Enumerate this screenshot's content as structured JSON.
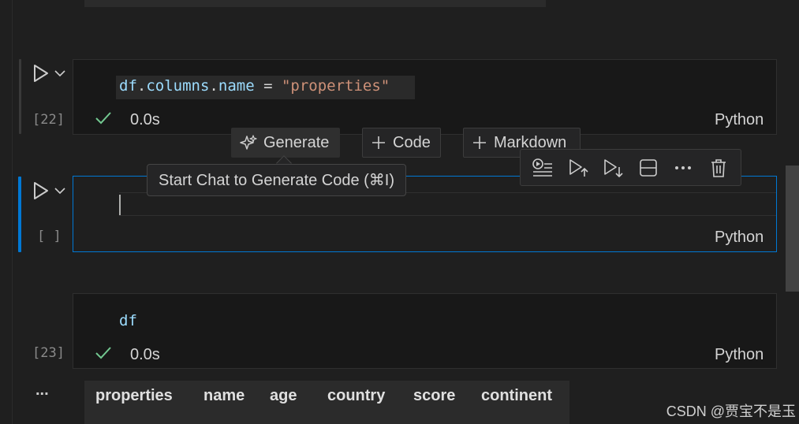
{
  "cells": [
    {
      "code_tokens": [
        {
          "text": "df",
          "kind": "var"
        },
        {
          "text": ".",
          "kind": "op"
        },
        {
          "text": "columns",
          "kind": "var"
        },
        {
          "text": ".",
          "kind": "op"
        },
        {
          "text": "name",
          "kind": "var"
        },
        {
          "text": " = ",
          "kind": "op"
        },
        {
          "text": "\"properties\"",
          "kind": "str"
        }
      ],
      "exec_count": "[22]",
      "status_time": "0.0s",
      "language": "Python"
    },
    {
      "code_tokens": [],
      "exec_count": "[ ]",
      "language": "Python"
    },
    {
      "code_tokens": [
        {
          "text": "df",
          "kind": "var"
        }
      ],
      "exec_count": "[23]",
      "status_time": "0.0s",
      "language": "Python"
    }
  ],
  "insert_bar": {
    "generate_label": "Generate",
    "code_label": "Code",
    "markdown_label": "Markdown"
  },
  "tooltip": {
    "text": "Start Chat to Generate Code (⌘I)"
  },
  "cell_toolbar": {
    "icons": [
      "run-by-line-icon",
      "execute-above-icon",
      "execute-below-icon",
      "split-cell-icon",
      "more-icon",
      "delete-icon"
    ]
  },
  "output": {
    "more_label": "...",
    "columns": [
      "properties",
      "name",
      "age",
      "country",
      "score",
      "continent"
    ]
  },
  "watermark": "CSDN @贾宝不是玉",
  "colors": {
    "accent": "#0078d4",
    "success": "#73c991",
    "string": "#ce9178",
    "variable": "#9cdcfe"
  }
}
